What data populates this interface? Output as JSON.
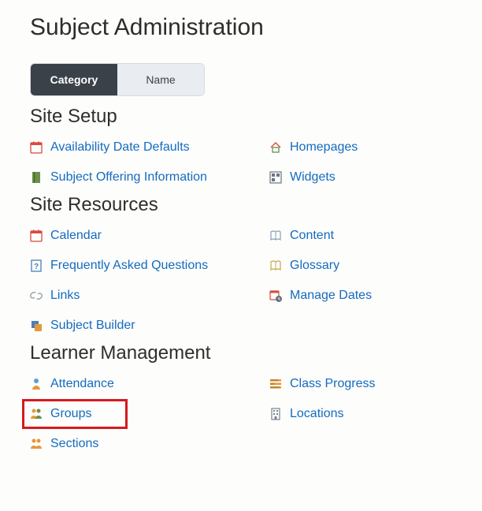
{
  "page": {
    "title": "Subject Administration"
  },
  "tabs": {
    "category": "Category",
    "name": "Name"
  },
  "sections": {
    "site_setup": {
      "title": "Site Setup",
      "items": {
        "avail": "Availability Date Defaults",
        "homepages": "Homepages",
        "offering": "Subject Offering Information",
        "widgets": "Widgets"
      }
    },
    "site_resources": {
      "title": "Site Resources",
      "items": {
        "calendar": "Calendar",
        "content": "Content",
        "faq": "Frequently Asked Questions",
        "glossary": "Glossary",
        "links": "Links",
        "manage_dates": "Manage Dates",
        "subject_builder": "Subject Builder"
      }
    },
    "learner_mgmt": {
      "title": "Learner Management",
      "items": {
        "attendance": "Attendance",
        "class_progress": "Class Progress",
        "groups": "Groups",
        "locations": "Locations",
        "sections": "Sections"
      }
    }
  }
}
